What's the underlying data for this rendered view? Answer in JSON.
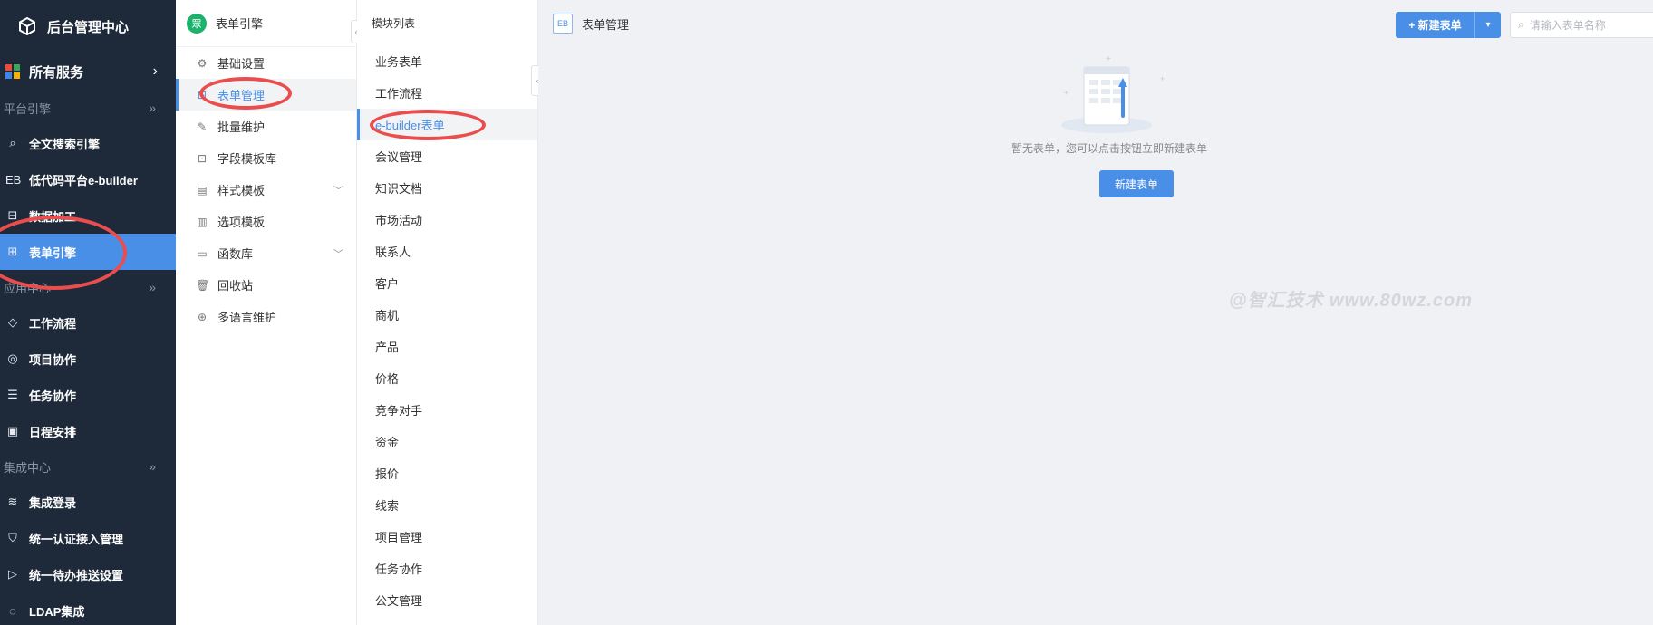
{
  "sidebar": {
    "logo_text": "后台管理中心",
    "all_services": "所有服务",
    "groups": [
      {
        "title": "平台引擎",
        "items": [
          {
            "icon": "search-icon",
            "glyph": "⌕",
            "label": "全文搜索引擎"
          },
          {
            "icon": "eb-icon",
            "glyph": "EB",
            "label": "低代码平台e-builder"
          },
          {
            "icon": "data-icon",
            "glyph": "⊟",
            "label": "数据加工"
          },
          {
            "icon": "form-engine-icon",
            "glyph": "⊞",
            "label": "表单引擎",
            "active": true
          }
        ]
      },
      {
        "title": "应用中心",
        "items": [
          {
            "icon": "layers-icon",
            "glyph": "◇",
            "label": "工作流程"
          },
          {
            "icon": "compass-icon",
            "glyph": "◎",
            "label": "项目协作"
          },
          {
            "icon": "list-icon",
            "glyph": "☰",
            "label": "任务协作"
          },
          {
            "icon": "calendar-icon",
            "glyph": "▣",
            "label": "日程安排"
          }
        ]
      },
      {
        "title": "集成中心",
        "items": [
          {
            "icon": "database-icon",
            "glyph": "≋",
            "label": "集成登录"
          },
          {
            "icon": "shield-icon",
            "glyph": "⛉",
            "label": "统一认证接入管理"
          },
          {
            "icon": "send-icon",
            "glyph": "▷",
            "label": "统一待办推送设置"
          },
          {
            "icon": "loop-icon",
            "glyph": "◌",
            "label": "LDAP集成"
          }
        ]
      }
    ]
  },
  "menu2": {
    "title": "表单引擎",
    "badge": "眾",
    "items": [
      {
        "icon": "settings-icon",
        "glyph": "⚙",
        "label": "基础设置"
      },
      {
        "icon": "form-manage-icon",
        "glyph": "⊟",
        "label": "表单管理",
        "active": true
      },
      {
        "icon": "batch-icon",
        "glyph": "✎",
        "label": "批量维护"
      },
      {
        "icon": "field-template-icon",
        "glyph": "⊡",
        "label": "字段模板库"
      },
      {
        "icon": "style-template-icon",
        "glyph": "▤",
        "label": "样式模板",
        "expandable": true
      },
      {
        "icon": "option-template-icon",
        "glyph": "▥",
        "label": "选项模板"
      },
      {
        "icon": "function-icon",
        "glyph": "▭",
        "label": "函数库",
        "expandable": true
      },
      {
        "icon": "trash-icon",
        "glyph": "🗑",
        "label": "回收站"
      },
      {
        "icon": "globe-icon",
        "glyph": "⊕",
        "label": "多语言维护"
      }
    ]
  },
  "modules": {
    "title": "模块列表",
    "items": [
      "业务表单",
      "工作流程",
      "e-builder表单",
      "会议管理",
      "知识文档",
      "市场活动",
      "联系人",
      "客户",
      "商机",
      "产品",
      "价格",
      "竞争对手",
      "资金",
      "报价",
      "线索",
      "项目管理",
      "任务协作",
      "公文管理"
    ],
    "active_index": 2
  },
  "main": {
    "header_badge": "EB",
    "header_title": "表单管理",
    "new_button": "+ 新建表单",
    "search_placeholder": "请输入表单名称",
    "empty_text": "暂无表单，您可以点击按钮立即新建表单",
    "empty_button": "新建表单",
    "watermark": "@智汇技术 www.80wz.com"
  },
  "colors": {
    "sidebar_bg": "#1e2a3a",
    "accent": "#4a8fe7",
    "badge_green": "#1bb26b",
    "annotation_red": "#ea4d4d"
  }
}
